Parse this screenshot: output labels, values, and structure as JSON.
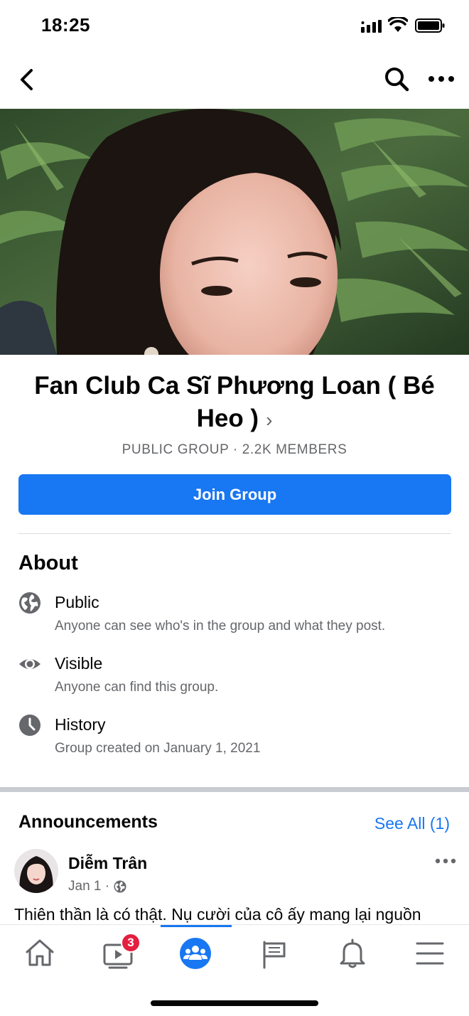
{
  "status_bar": {
    "time": "18:25"
  },
  "group": {
    "name": "Fan Club Ca Sĩ Phương Loan ( Bé Heo )",
    "name_chevron": "›",
    "meta": "PUBLIC GROUP · 2.2K MEMBERS",
    "join_label": "Join Group"
  },
  "about": {
    "title": "About",
    "items": [
      {
        "icon": "globe-icon",
        "heading": "Public",
        "sub": "Anyone can see who's in the group and what they post."
      },
      {
        "icon": "eye-icon",
        "heading": "Visible",
        "sub": "Anyone can find this group."
      },
      {
        "icon": "clock-icon",
        "heading": "History",
        "sub": "Group created on January 1, 2021"
      }
    ]
  },
  "announcements": {
    "title": "Announcements",
    "see_all": "See All (1)",
    "post": {
      "author": "Diễm Trân",
      "date": "Jan 1 ·",
      "text": "Thiên thần là có thật. Nụ cười của cô ấy mang lại nguồn"
    }
  },
  "tab_bar": {
    "tabs": [
      "home-icon",
      "video-icon",
      "groups-icon",
      "pages-flag-icon",
      "bell-icon",
      "menu-icon"
    ],
    "active": "groups-icon",
    "video_badge": "3"
  },
  "colors": {
    "accent": "#1877f2",
    "badge": "#e41e3f",
    "secondary_text": "#65676b"
  }
}
